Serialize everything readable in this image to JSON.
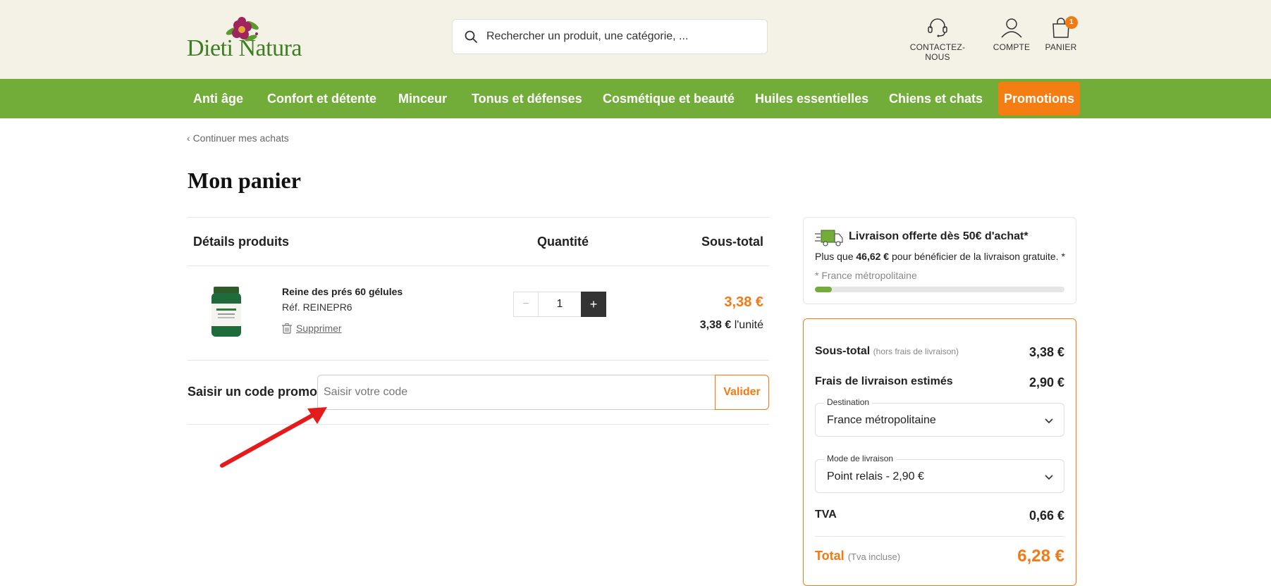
{
  "header": {
    "logo_text": "Dieti Natura",
    "search_placeholder": "Rechercher un produit, une catégorie, ...",
    "contact_label": "CONTACTEZ-NOUS",
    "account_label": "COMPTE",
    "cart_label": "PANIER",
    "cart_count": "1"
  },
  "nav": {
    "items": [
      "Anti âge",
      "Confort et détente",
      "Minceur",
      "Tonus et défenses",
      "Cosmétique et beauté",
      "Huiles essentielles",
      "Chiens et chats"
    ],
    "promo": "Promotions"
  },
  "breadcrumb": {
    "back": "Continuer mes achats"
  },
  "page": {
    "title": "Mon panier"
  },
  "table": {
    "col_product": "Détails produits",
    "col_qty": "Quantité",
    "col_subtotal": "Sous-total"
  },
  "item": {
    "name": "Reine des prés 60 gélules",
    "ref": "Réf. REINEPR6",
    "delete_label": "Supprimer",
    "qty_minus": "−",
    "quantity": "1",
    "qty_plus": "+",
    "line_total": "3,38 €",
    "unit_price": "3,38 €",
    "unit_suffix": " l'unité"
  },
  "promo": {
    "label": "Saisir un code promo",
    "placeholder": "Saisir votre code",
    "button": "Valider"
  },
  "shipping": {
    "title": "Livraison offerte dès 50€ d'achat*",
    "remaining_prefix": "Plus que ",
    "remaining_amount": "46,62 €",
    "remaining_suffix": " pour bénéficier de la livraison gratuite. *",
    "note": "* France métropolitaine",
    "progress_fraction": 0.068
  },
  "summary": {
    "subtotal_label": "Sous-total",
    "subtotal_hint": "(hors frais de livraison)",
    "subtotal_value": "3,38 €",
    "shipping_label": "Frais de livraison estimés",
    "shipping_value": "2,90 €",
    "destination_legend": "Destination",
    "destination_value": "France métropolitaine",
    "mode_legend": "Mode de livraison",
    "mode_value": "Point relais - 2,90 €",
    "tva_label": "TVA",
    "tva_value": "0,66 €",
    "total_label": "Total",
    "total_hint": "(Tva incluse)",
    "total_value": "6,28 €"
  },
  "colors": {
    "brand_green": "#72ad3a",
    "accent_orange": "#f27a12",
    "header_bg": "#f4f2e6"
  }
}
